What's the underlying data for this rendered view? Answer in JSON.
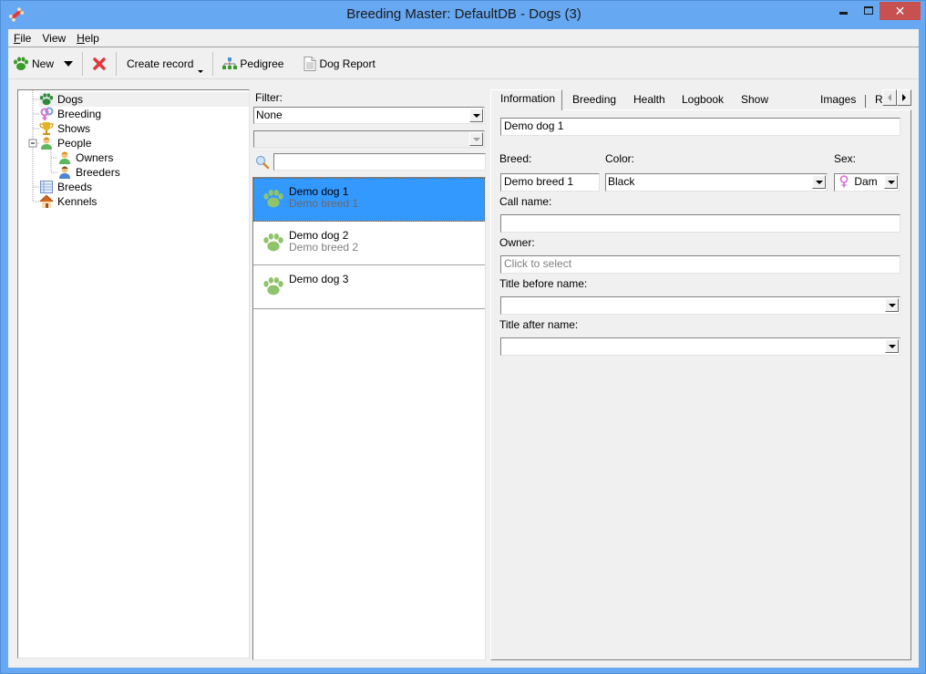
{
  "window": {
    "title": "Breeding Master: DefaultDB - Dogs (3)",
    "app_icon": "bone-icon",
    "controls": {
      "minimize": "minimize-icon",
      "maximize": "maximize-icon",
      "close": "close-icon"
    }
  },
  "menu": {
    "items": [
      {
        "label": "File",
        "accel": "F",
        "rest": "ile"
      },
      {
        "label": "View",
        "accel": "",
        "rest": "View"
      },
      {
        "label": "Help",
        "accel": "H",
        "rest": "elp"
      }
    ]
  },
  "toolbar": {
    "new_label": "New",
    "new_icon": "paw-icon",
    "delete_icon": "delete-x-icon",
    "create_record_label": "Create record",
    "pedigree_label": "Pedigree",
    "pedigree_icon": "pedigree-tree-icon",
    "dog_report_label": "Dog Report",
    "dog_report_icon": "document-icon"
  },
  "tree": {
    "items": [
      {
        "label": "Dogs",
        "icon": "paw-icon",
        "level": 0,
        "selected": true
      },
      {
        "label": "Breeding",
        "icon": "gender-symbols-icon",
        "level": 0
      },
      {
        "label": "Shows",
        "icon": "trophy-icon",
        "level": 0
      },
      {
        "label": "People",
        "icon": "person-icon",
        "level": 0,
        "expanded": true
      },
      {
        "label": "Owners",
        "icon": "person-icon",
        "level": 1
      },
      {
        "label": "Breeders",
        "icon": "person-blue-icon",
        "level": 1
      },
      {
        "label": "Breeds",
        "icon": "table-icon",
        "level": 0
      },
      {
        "label": "Kennels",
        "icon": "house-icon",
        "level": 0
      }
    ]
  },
  "filter": {
    "label": "Filter:",
    "primary_value": "None",
    "secondary_value": "",
    "search_value": "",
    "search_icon": "magnifier-icon"
  },
  "dogs": {
    "items": [
      {
        "name": "Demo dog 1",
        "breed": "Demo breed 1",
        "selected": true
      },
      {
        "name": "Demo dog 2",
        "breed": "Demo breed 2",
        "selected": false
      },
      {
        "name": "Demo dog 3",
        "breed": "",
        "selected": false
      }
    ]
  },
  "tabs": {
    "items": [
      {
        "label": "Information",
        "active": true
      },
      {
        "label": "Breeding"
      },
      {
        "label": "Health"
      },
      {
        "label": "Logbook"
      },
      {
        "label": "Show Results"
      },
      {
        "label": "Images"
      },
      {
        "label": "R"
      }
    ]
  },
  "info": {
    "name_value": "Demo dog 1",
    "breed_label": "Breed:",
    "breed_value": "Demo breed 1",
    "color_label": "Color:",
    "color_value": "Black",
    "sex_label": "Sex:",
    "sex_value": "Dam",
    "sex_icon": "female-icon",
    "call_name_label": "Call name:",
    "call_name_value": "",
    "owner_label": "Owner:",
    "owner_placeholder": "Click to select",
    "title_before_label": "Title before name:",
    "title_before_value": "",
    "title_after_label": "Title after name:",
    "title_after_value": ""
  }
}
